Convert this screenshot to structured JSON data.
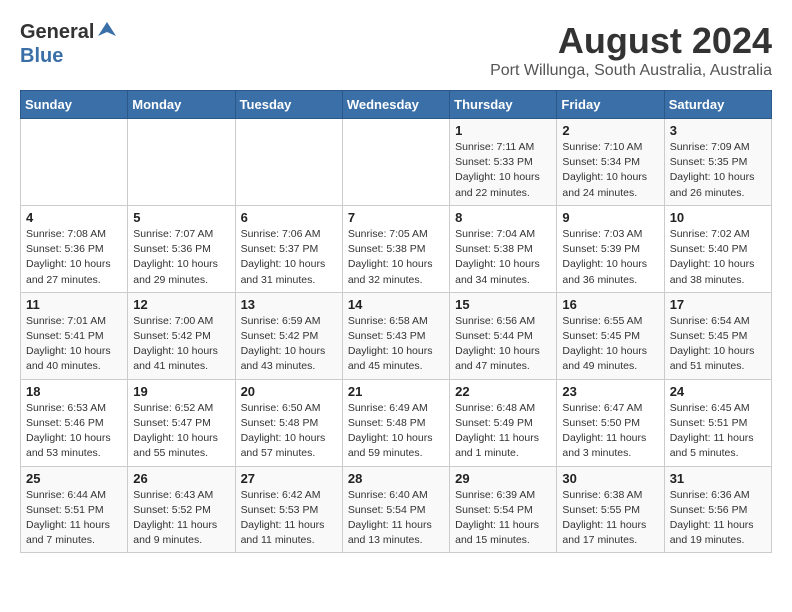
{
  "logo": {
    "general": "General",
    "blue": "Blue"
  },
  "title": {
    "month_year": "August 2024",
    "location": "Port Willunga, South Australia, Australia"
  },
  "headers": [
    "Sunday",
    "Monday",
    "Tuesday",
    "Wednesday",
    "Thursday",
    "Friday",
    "Saturday"
  ],
  "weeks": [
    [
      {
        "day": "",
        "info": ""
      },
      {
        "day": "",
        "info": ""
      },
      {
        "day": "",
        "info": ""
      },
      {
        "day": "",
        "info": ""
      },
      {
        "day": "1",
        "info": "Sunrise: 7:11 AM\nSunset: 5:33 PM\nDaylight: 10 hours\nand 22 minutes."
      },
      {
        "day": "2",
        "info": "Sunrise: 7:10 AM\nSunset: 5:34 PM\nDaylight: 10 hours\nand 24 minutes."
      },
      {
        "day": "3",
        "info": "Sunrise: 7:09 AM\nSunset: 5:35 PM\nDaylight: 10 hours\nand 26 minutes."
      }
    ],
    [
      {
        "day": "4",
        "info": "Sunrise: 7:08 AM\nSunset: 5:36 PM\nDaylight: 10 hours\nand 27 minutes."
      },
      {
        "day": "5",
        "info": "Sunrise: 7:07 AM\nSunset: 5:36 PM\nDaylight: 10 hours\nand 29 minutes."
      },
      {
        "day": "6",
        "info": "Sunrise: 7:06 AM\nSunset: 5:37 PM\nDaylight: 10 hours\nand 31 minutes."
      },
      {
        "day": "7",
        "info": "Sunrise: 7:05 AM\nSunset: 5:38 PM\nDaylight: 10 hours\nand 32 minutes."
      },
      {
        "day": "8",
        "info": "Sunrise: 7:04 AM\nSunset: 5:38 PM\nDaylight: 10 hours\nand 34 minutes."
      },
      {
        "day": "9",
        "info": "Sunrise: 7:03 AM\nSunset: 5:39 PM\nDaylight: 10 hours\nand 36 minutes."
      },
      {
        "day": "10",
        "info": "Sunrise: 7:02 AM\nSunset: 5:40 PM\nDaylight: 10 hours\nand 38 minutes."
      }
    ],
    [
      {
        "day": "11",
        "info": "Sunrise: 7:01 AM\nSunset: 5:41 PM\nDaylight: 10 hours\nand 40 minutes."
      },
      {
        "day": "12",
        "info": "Sunrise: 7:00 AM\nSunset: 5:42 PM\nDaylight: 10 hours\nand 41 minutes."
      },
      {
        "day": "13",
        "info": "Sunrise: 6:59 AM\nSunset: 5:42 PM\nDaylight: 10 hours\nand 43 minutes."
      },
      {
        "day": "14",
        "info": "Sunrise: 6:58 AM\nSunset: 5:43 PM\nDaylight: 10 hours\nand 45 minutes."
      },
      {
        "day": "15",
        "info": "Sunrise: 6:56 AM\nSunset: 5:44 PM\nDaylight: 10 hours\nand 47 minutes."
      },
      {
        "day": "16",
        "info": "Sunrise: 6:55 AM\nSunset: 5:45 PM\nDaylight: 10 hours\nand 49 minutes."
      },
      {
        "day": "17",
        "info": "Sunrise: 6:54 AM\nSunset: 5:45 PM\nDaylight: 10 hours\nand 51 minutes."
      }
    ],
    [
      {
        "day": "18",
        "info": "Sunrise: 6:53 AM\nSunset: 5:46 PM\nDaylight: 10 hours\nand 53 minutes."
      },
      {
        "day": "19",
        "info": "Sunrise: 6:52 AM\nSunset: 5:47 PM\nDaylight: 10 hours\nand 55 minutes."
      },
      {
        "day": "20",
        "info": "Sunrise: 6:50 AM\nSunset: 5:48 PM\nDaylight: 10 hours\nand 57 minutes."
      },
      {
        "day": "21",
        "info": "Sunrise: 6:49 AM\nSunset: 5:48 PM\nDaylight: 10 hours\nand 59 minutes."
      },
      {
        "day": "22",
        "info": "Sunrise: 6:48 AM\nSunset: 5:49 PM\nDaylight: 11 hours\nand 1 minute."
      },
      {
        "day": "23",
        "info": "Sunrise: 6:47 AM\nSunset: 5:50 PM\nDaylight: 11 hours\nand 3 minutes."
      },
      {
        "day": "24",
        "info": "Sunrise: 6:45 AM\nSunset: 5:51 PM\nDaylight: 11 hours\nand 5 minutes."
      }
    ],
    [
      {
        "day": "25",
        "info": "Sunrise: 6:44 AM\nSunset: 5:51 PM\nDaylight: 11 hours\nand 7 minutes."
      },
      {
        "day": "26",
        "info": "Sunrise: 6:43 AM\nSunset: 5:52 PM\nDaylight: 11 hours\nand 9 minutes."
      },
      {
        "day": "27",
        "info": "Sunrise: 6:42 AM\nSunset: 5:53 PM\nDaylight: 11 hours\nand 11 minutes."
      },
      {
        "day": "28",
        "info": "Sunrise: 6:40 AM\nSunset: 5:54 PM\nDaylight: 11 hours\nand 13 minutes."
      },
      {
        "day": "29",
        "info": "Sunrise: 6:39 AM\nSunset: 5:54 PM\nDaylight: 11 hours\nand 15 minutes."
      },
      {
        "day": "30",
        "info": "Sunrise: 6:38 AM\nSunset: 5:55 PM\nDaylight: 11 hours\nand 17 minutes."
      },
      {
        "day": "31",
        "info": "Sunrise: 6:36 AM\nSunset: 5:56 PM\nDaylight: 11 hours\nand 19 minutes."
      }
    ]
  ]
}
